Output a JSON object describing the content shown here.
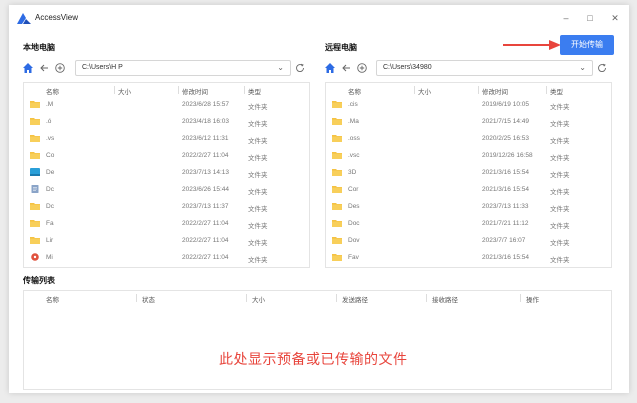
{
  "app": {
    "title": "AccessView"
  },
  "window_controls": {
    "minimize": "–",
    "maximize": "□",
    "close": "✕"
  },
  "local": {
    "title": "本地电脑",
    "path": "C:\\Users\\H P",
    "columns": [
      "名称",
      "大小",
      "修改时间",
      "类型"
    ],
    "rows": [
      {
        "icon": "folder-icon",
        "name": ".M",
        "size": "",
        "date": "2023/6/28 15:57",
        "type": "文件夹"
      },
      {
        "icon": "folder-icon",
        "name": ".ó",
        "size": "",
        "date": "2023/4/18 16:03",
        "type": "文件夹"
      },
      {
        "icon": "folder-icon",
        "name": ".vs",
        "size": "",
        "date": "2023/6/12 11:31",
        "type": "文件夹"
      },
      {
        "icon": "folder-icon",
        "name": "Co",
        "size": "",
        "date": "2022/2/27 11:04",
        "type": "文件夹"
      },
      {
        "icon": "desktop-folder-icon",
        "name": "De",
        "size": "",
        "date": "2023/7/13 14:13",
        "type": "文件夹"
      },
      {
        "icon": "documents-folder-icon",
        "name": "Dc",
        "size": "",
        "date": "2023/6/26 15:44",
        "type": "文件夹"
      },
      {
        "icon": "folder-icon",
        "name": "Dc",
        "size": "",
        "date": "2023/7/13 11:37",
        "type": "文件夹"
      },
      {
        "icon": "folder-icon",
        "name": "Fa",
        "size": "",
        "date": "2022/2/27 11:04",
        "type": "文件夹"
      },
      {
        "icon": "folder-icon",
        "name": "Lir",
        "size": "",
        "date": "2022/2/27 11:04",
        "type": "文件夹"
      },
      {
        "icon": "music-folder-icon",
        "name": "Mi",
        "size": "",
        "date": "2022/2/27 11:04",
        "type": "文件夹"
      }
    ]
  },
  "remote": {
    "title": "远程电脑",
    "path": "C:\\Users\\34980",
    "columns": [
      "名称",
      "大小",
      "修改时间",
      "类型"
    ],
    "rows": [
      {
        "icon": "folder-icon",
        "name": ".cis",
        "size": "",
        "date": "2019/6/19 10:05",
        "type": "文件夹"
      },
      {
        "icon": "folder-icon",
        "name": ".Ma",
        "size": "",
        "date": "2021/7/15 14:49",
        "type": "文件夹"
      },
      {
        "icon": "folder-icon",
        "name": ".oss",
        "size": "",
        "date": "2020/2/25 16:53",
        "type": "文件夹"
      },
      {
        "icon": "folder-icon",
        "name": ".vsc",
        "size": "",
        "date": "2019/12/26 16:58",
        "type": "文件夹"
      },
      {
        "icon": "folder-icon",
        "name": "3D ",
        "size": "",
        "date": "2021/3/16 15:54",
        "type": "文件夹"
      },
      {
        "icon": "folder-icon",
        "name": "Cor",
        "size": "",
        "date": "2021/3/16 15:54",
        "type": "文件夹"
      },
      {
        "icon": "folder-icon",
        "name": "Des",
        "size": "",
        "date": "2023/7/13 11:33",
        "type": "文件夹"
      },
      {
        "icon": "folder-icon",
        "name": "Doc",
        "size": "",
        "date": "2021/7/21 11:12",
        "type": "文件夹"
      },
      {
        "icon": "folder-icon",
        "name": "Dov",
        "size": "",
        "date": "2023/7/7 16:07",
        "type": "文件夹"
      },
      {
        "icon": "folder-icon",
        "name": "Fav",
        "size": "",
        "date": "2021/3/16 15:54",
        "type": "文件夹"
      }
    ]
  },
  "start_button": {
    "label": "开始传输"
  },
  "transfer": {
    "title": "传输列表",
    "columns": [
      "名称",
      "状态",
      "大小",
      "发送路径",
      "接收路径",
      "操作"
    ],
    "placeholder": "此处显示预备或已传输的文件"
  },
  "colors": {
    "accent": "#3b7df0",
    "annotation_red": "#e8453c",
    "folder_yellow": "#f5c242"
  }
}
